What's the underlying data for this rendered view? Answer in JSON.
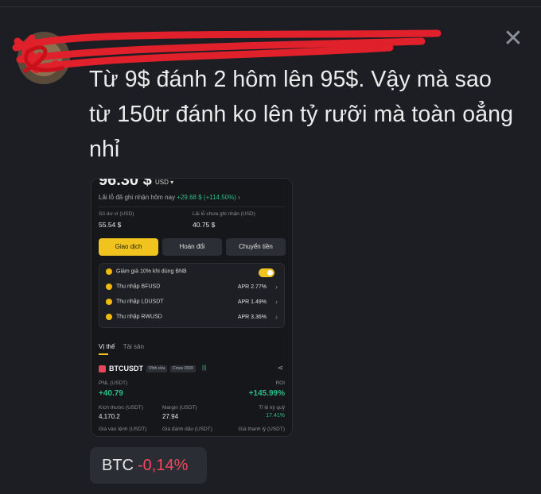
{
  "post": {
    "text_line1": "Từ 9$ đánh 2 hôm lên 95$. Vậy mà sao",
    "text_line2": "từ 150tr đánh ko lên tỷ rưỡi mà toàn oẳng",
    "text_line3": "nhỉ",
    "close_icon": "close-icon"
  },
  "screenshot": {
    "balance": "96.30 $",
    "currency": "USD ▾",
    "pnl_today_label": "Lãi lỗ đã ghi nhận hôm nay",
    "pnl_today_value": "+29.68 $ (+114.50%)",
    "pnl_today_chevron": "›",
    "wallet_balance_label": "Số dư ví (USD)",
    "wallet_balance_value": "55.54 $",
    "unrealized_pnl_label": "Lãi lỗ chưa ghi nhận (USD)",
    "unrealized_pnl_value": "40.75 $",
    "buttons": {
      "trade": "Giao dịch",
      "swap": "Hoán đổi",
      "transfer": "Chuyển tiền"
    },
    "card_rows": [
      {
        "label": "Giảm giá 10% khi dùng BNB",
        "apr": "",
        "icon": "bnb-coin-icon"
      },
      {
        "label": "Thu nhập BFUSD",
        "apr": "APR 2.77%",
        "icon": "bfusd-coin-icon"
      },
      {
        "label": "Thu nhập LDUSDT",
        "apr": "APR 1.49%",
        "icon": "ldusdt-coin-icon"
      },
      {
        "label": "Thu nhập RWUSD",
        "apr": "APR 3.36%",
        "icon": "rwusd-coin-icon"
      }
    ],
    "tabs": {
      "positions": "Vị thế",
      "assets": "Tài sản"
    },
    "position": {
      "symbol": "BTCUSDT",
      "type_badge": "Vĩnh cửu",
      "leverage_badge": "Cross 150X",
      "pnl_label": "PNL (USDT)",
      "pnl_value": "+40.79",
      "roi_label": "ROI",
      "roi_value": "+145.99%",
      "size_label": "Kích thước (USDT)",
      "size_value": "4,170.2",
      "margin_label": "Margin (USDT)",
      "margin_value": "27.94",
      "margin_ratio_label": "Tỉ lệ ký quỹ",
      "margin_ratio_value": "17.41%",
      "entry_price_label": "Giá vào lệnh (USDT)",
      "mark_price_label": "Giá đánh dấu (USDT)",
      "liq_price_label": "Giá thanh lý (USDT)"
    }
  },
  "ticker": {
    "symbol": "BTC",
    "change": "-0,14%"
  },
  "colors": {
    "accent_yellow": "#f0c31e",
    "green": "#2ebd85",
    "red": "#f6465d",
    "background": "#1c1e24"
  }
}
